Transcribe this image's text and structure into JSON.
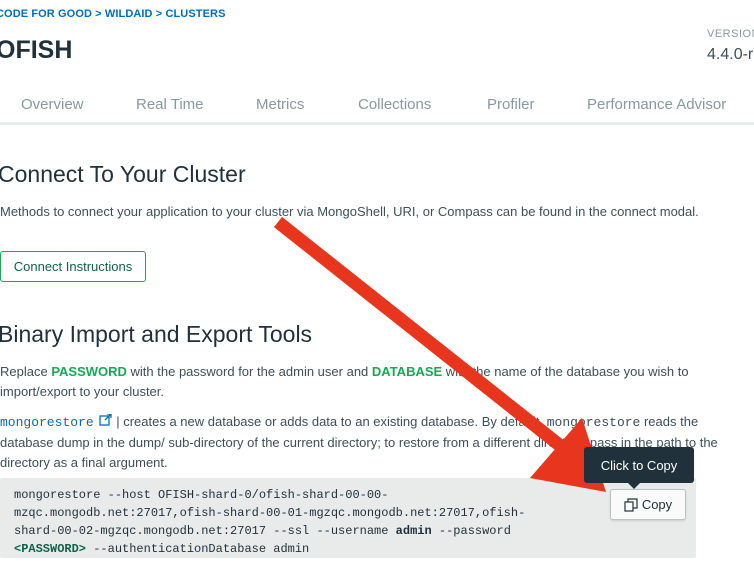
{
  "breadcrumb": "CODE FOR GOOD > WILDAID > CLUSTERS",
  "cluster_name": "OFISH",
  "version": {
    "label": "VERSION",
    "value": "4.4.0-r"
  },
  "tabs": [
    {
      "label": "Overview"
    },
    {
      "label": "Real Time"
    },
    {
      "label": "Metrics"
    },
    {
      "label": "Collections"
    },
    {
      "label": "Profiler"
    },
    {
      "label": "Performance Advisor"
    }
  ],
  "connect": {
    "heading": "Connect To Your Cluster",
    "description": "Methods to connect your application to your cluster via MongoShell, URI, or Compass can be found in the connect modal.",
    "button_label": "Connect Instructions"
  },
  "tools": {
    "heading": "Binary Import and Export Tools",
    "replace_prefix": "Replace ",
    "password_word": "PASSWORD",
    "replace_middle": " with the password for the admin user and ",
    "database_word": "DATABASE",
    "replace_suffix": " with the name of the database you wish to import/export to your cluster.",
    "mongorestore_link": "mongorestore",
    "mongorestore_desc1": " | creates a new database or adds data to an existing database. By default, ",
    "mongorestore_inline": "mongorestore",
    "mongorestore_desc2": " reads the database dump in the dump/ sub-directory of the current directory; to restore from a different directory, pass in the path to the directory as a final argument.",
    "code_line1": "mongorestore --host OFISH-shard-0/ofish-shard-00-00-",
    "code_line2": "mzqc.mongodb.net:27017,ofish-shard-00-01-mgzqc.mongodb.net:27017,ofish-",
    "code_line3a": "shard-00-02-mgzqc.mongodb.net:27017 --ssl --username ",
    "code_admin": "admin",
    "code_line3b": " --password",
    "code_password": "<PASSWORD>",
    "code_line4": " --authenticationDatabase admin",
    "tooltip": "Click to Copy",
    "copy_label": "Copy"
  },
  "colors": {
    "accent_green": "#13aa52",
    "link_blue": "#006cbc",
    "annotation_arrow": "#e8361e"
  }
}
